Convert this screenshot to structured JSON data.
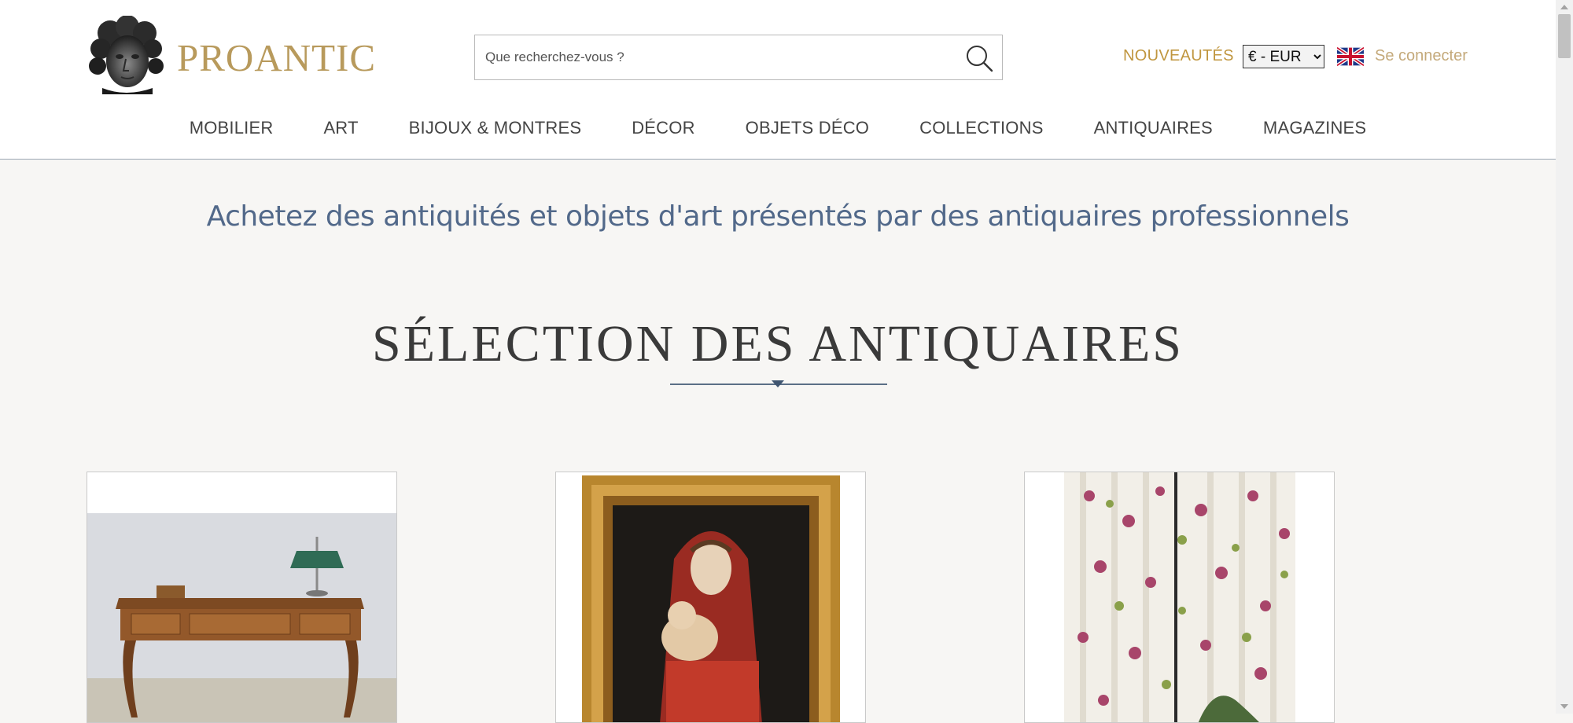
{
  "header": {
    "brand": "PROANTIC",
    "search": {
      "placeholder": "Que recherchez-vous ?"
    },
    "nouveautes": "NOUVEAUTÉS",
    "currency": {
      "selected": "€ - EUR"
    },
    "login": "Se connecter"
  },
  "nav": {
    "items": [
      {
        "label": "MOBILIER"
      },
      {
        "label": "ART"
      },
      {
        "label": "BIJOUX & MONTRES"
      },
      {
        "label": "DÉCOR"
      },
      {
        "label": "OBJETS DÉCO"
      },
      {
        "label": "COLLECTIONS"
      },
      {
        "label": "ANTIQUAIRES"
      },
      {
        "label": "MAGAZINES"
      }
    ]
  },
  "main": {
    "tagline": "Achetez des antiquités et objets d'art présentés par des antiquaires professionnels",
    "section_title": "SÉLECTION DES ANTIQUAIRES"
  },
  "icons": {
    "logo": "classical-head-logo",
    "search": "search-icon",
    "flag": "uk-flag-icon"
  },
  "colors": {
    "brand_gold": "#b89a5c",
    "nav_text": "#444444",
    "tagline_blue": "#52698a",
    "page_bg": "#f7f6f4"
  }
}
